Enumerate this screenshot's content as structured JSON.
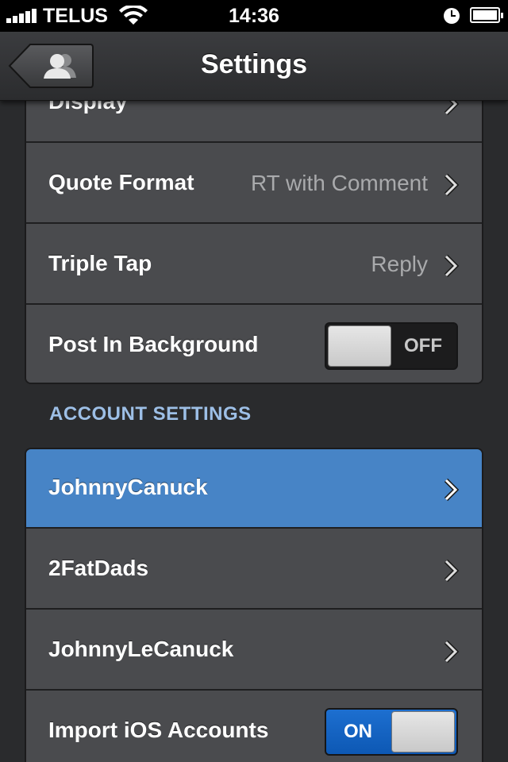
{
  "status_bar": {
    "carrier": "TELUS",
    "time": "14:36"
  },
  "nav": {
    "title": "Settings",
    "back_icon": "contacts-person-icon"
  },
  "display_group": {
    "rows": [
      {
        "label": "Display"
      },
      {
        "label": "Quote Format",
        "value": "RT with Comment"
      },
      {
        "label": "Triple Tap",
        "value": "Reply"
      },
      {
        "label": "Post In Background",
        "toggle_text": "OFF",
        "toggle_state": "off"
      }
    ]
  },
  "account_section": {
    "header": "ACCOUNT SETTINGS",
    "rows": [
      {
        "label": "JohnnyCanuck",
        "selected": true
      },
      {
        "label": "2FatDads"
      },
      {
        "label": "JohnnyLeCanuck"
      },
      {
        "label": "Import iOS Accounts",
        "toggle_text": "ON",
        "toggle_state": "on"
      }
    ]
  },
  "colors": {
    "selected_row": "#4784c6",
    "section_header": "#9dbfe6",
    "switch_on": "#0d58b4"
  }
}
